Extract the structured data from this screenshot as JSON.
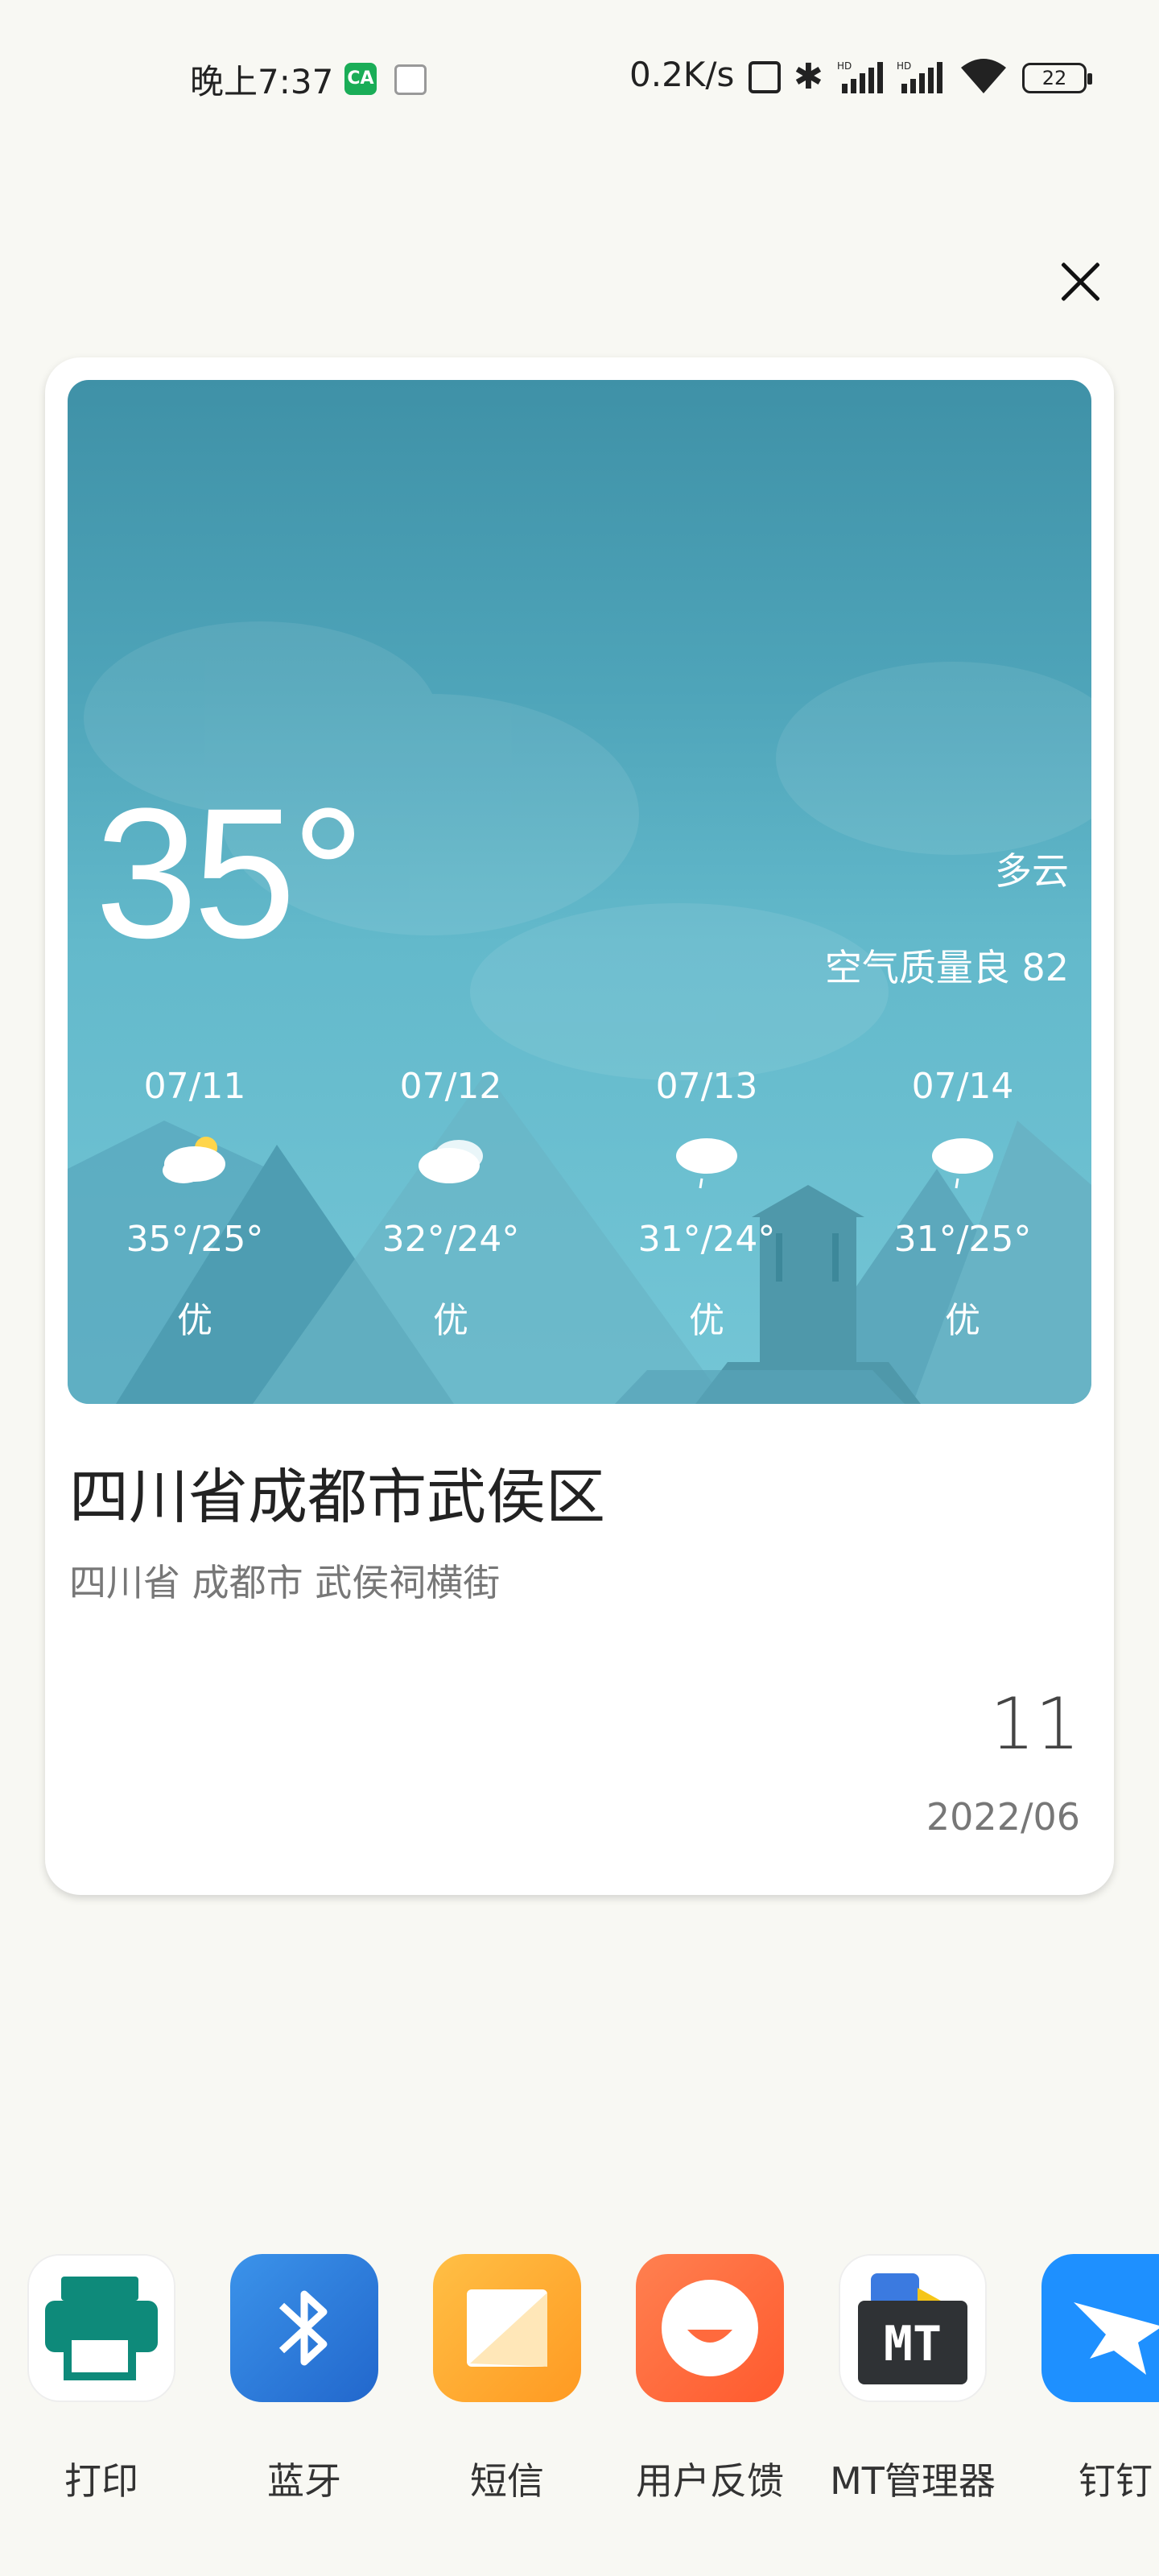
{
  "status_bar": {
    "time": "晚上7:37",
    "app_badge": "CA",
    "net_speed": "0.2K/s",
    "signal1_label": "HD",
    "signal2_label": "HD",
    "battery": "22"
  },
  "weather": {
    "temperature": "35°",
    "condition": "多云",
    "air_quality": "空气质量良 82",
    "forecast": [
      {
        "date": "07/11",
        "icon": "partly-sunny-icon",
        "range": "35°/25°",
        "quality": "优"
      },
      {
        "date": "07/12",
        "icon": "cloudy-icon",
        "range": "32°/24°",
        "quality": "优"
      },
      {
        "date": "07/13",
        "icon": "light-rain-icon",
        "range": "31°/24°",
        "quality": "优"
      },
      {
        "date": "07/14",
        "icon": "light-rain-icon",
        "range": "31°/25°",
        "quality": "优"
      }
    ]
  },
  "location": {
    "title": "四川省成都市武侯区",
    "subtitle": "四川省 成都市 武侯祠横街"
  },
  "date": {
    "day": "11",
    "year_month": "2022/06"
  },
  "apps": [
    {
      "label": "打印",
      "icon": "printer-icon"
    },
    {
      "label": "蓝牙",
      "icon": "bluetooth-icon"
    },
    {
      "label": "短信",
      "icon": "sms-icon"
    },
    {
      "label": "用户反馈",
      "icon": "feedback-icon"
    },
    {
      "label": "MT管理器",
      "icon": "mt-manager-icon",
      "icon_text": "MT"
    },
    {
      "label": "钉钉",
      "icon": "dingtalk-icon"
    }
  ],
  "colors": {
    "printer": "#0e8a7a",
    "bluetooth": "#2d7fde",
    "sms": "#ffab2e",
    "feedback": "#ff6a3d",
    "dingtalk": "#1e90ff"
  }
}
